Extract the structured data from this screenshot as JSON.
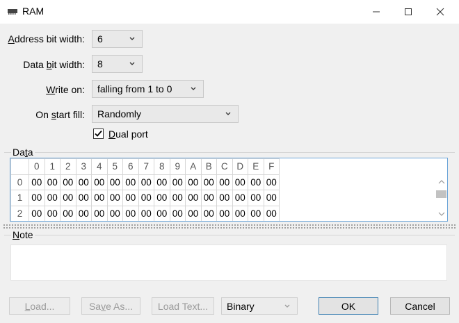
{
  "window": {
    "title": "RAM",
    "icons": {
      "app": "chip-icon",
      "minimize": "minimize-icon",
      "maximize": "maximize-icon",
      "close": "close-icon"
    }
  },
  "form": {
    "address_bit_width": {
      "label_key": "A",
      "label_rest": "ddress bit width:",
      "value": "6"
    },
    "data_bit_width": {
      "label_pre": "Data ",
      "label_key": "b",
      "label_rest": "it width:",
      "value": "8"
    },
    "write_on": {
      "label_key": "W",
      "label_rest": "rite on:",
      "value": "falling from 1 to 0"
    },
    "on_start_fill": {
      "label_pre": "On ",
      "label_key": "s",
      "label_rest": "tart fill:",
      "value": "Randomly"
    },
    "dual_port": {
      "label_key": "D",
      "label_rest": "ual port",
      "checked": true
    }
  },
  "data_group": {
    "title_pre": "Da",
    "title_key": "t",
    "title_rest": "a",
    "columns": [
      "0",
      "1",
      "2",
      "3",
      "4",
      "5",
      "6",
      "7",
      "8",
      "9",
      "A",
      "B",
      "C",
      "D",
      "E",
      "F"
    ],
    "rows": [
      {
        "header": "0",
        "cells": [
          "00",
          "00",
          "00",
          "00",
          "00",
          "00",
          "00",
          "00",
          "00",
          "00",
          "00",
          "00",
          "00",
          "00",
          "00",
          "00"
        ]
      },
      {
        "header": "1",
        "cells": [
          "00",
          "00",
          "00",
          "00",
          "00",
          "00",
          "00",
          "00",
          "00",
          "00",
          "00",
          "00",
          "00",
          "00",
          "00",
          "00"
        ]
      },
      {
        "header": "2",
        "cells": [
          "00",
          "00",
          "00",
          "00",
          "00",
          "00",
          "00",
          "00",
          "00",
          "00",
          "00",
          "00",
          "00",
          "00",
          "00",
          "00"
        ]
      }
    ]
  },
  "note_group": {
    "title_key": "N",
    "title_rest": "ote",
    "value": ""
  },
  "buttons": {
    "load": {
      "key": "L",
      "rest": "oad..."
    },
    "save_as": {
      "pre": "Sa",
      "key": "v",
      "rest": "e As..."
    },
    "load_text": {
      "label": "Load Text..."
    },
    "format": {
      "value": "Binary"
    },
    "ok": {
      "label": "OK"
    },
    "cancel": {
      "label": "Cancel"
    }
  }
}
